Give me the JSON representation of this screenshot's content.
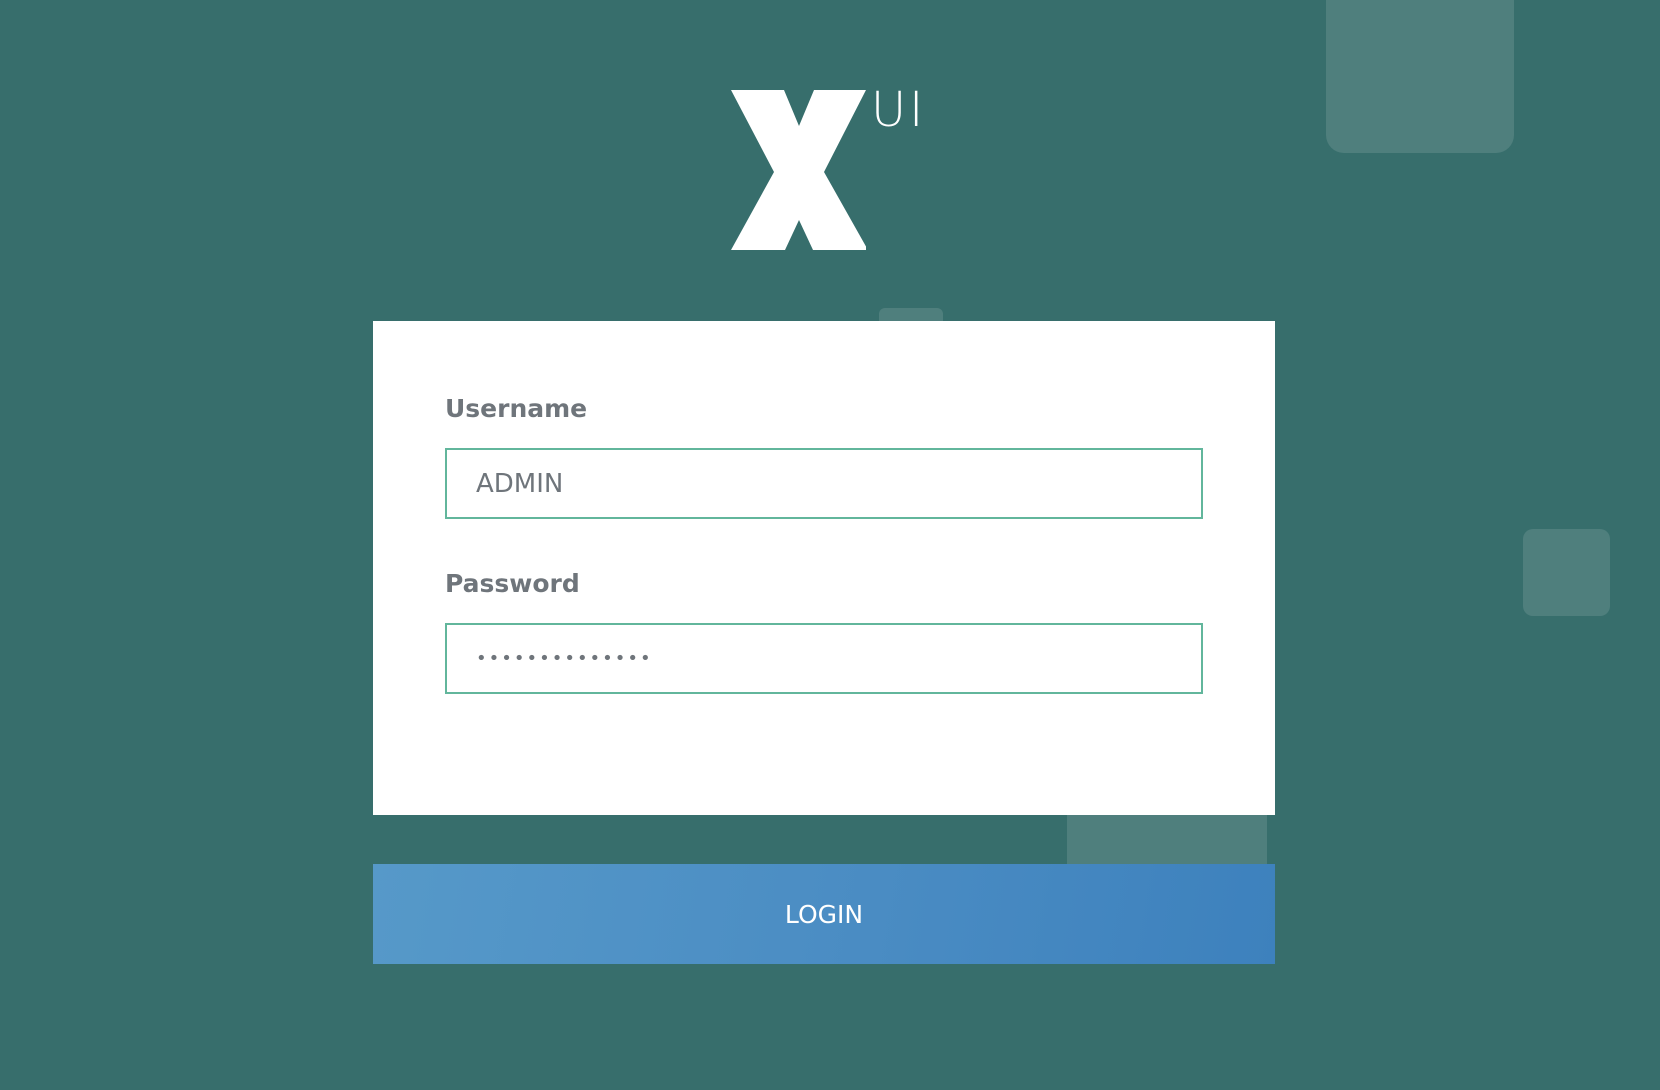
{
  "logo": {
    "mark": "X",
    "suffix": "UI"
  },
  "form": {
    "username_label": "Username",
    "username_value": "ADMIN",
    "password_label": "Password",
    "password_value": "••••••••••••••"
  },
  "login_button_label": "LOGIN",
  "colors": {
    "background": "#376e6c",
    "card": "#ffffff",
    "input_border": "#62b69c",
    "label_text": "#6f757b",
    "button_gradient_start": "#5699c9",
    "button_gradient_end": "#3d81bd"
  }
}
